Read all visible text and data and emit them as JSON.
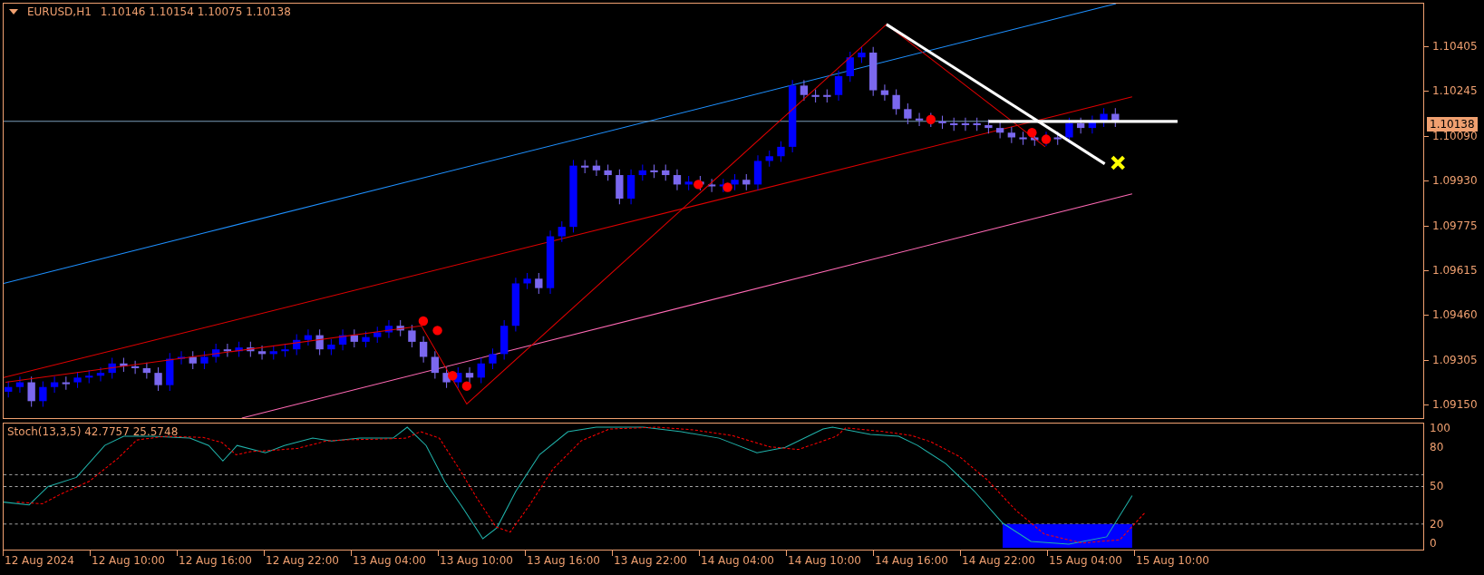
{
  "chart": {
    "symbol": "EURUSD,H1",
    "ohlc": "1.10146 1.10154 1.10075 1.10138",
    "current_price": "1.10138",
    "price_axis": [
      "1.10405",
      "1.10245",
      "1.10090",
      "1.09930",
      "1.09775",
      "1.09615",
      "1.09460",
      "1.09305",
      "1.09150"
    ]
  },
  "indicator": {
    "label": "Stoch(13,3,5) 42.7757 25.5748",
    "levels": [
      "100",
      "80",
      "50",
      "20",
      "0"
    ]
  },
  "time_axis": [
    "12 Aug 2024",
    "12 Aug 10:00",
    "12 Aug 16:00",
    "12 Aug 22:00",
    "13 Aug 04:00",
    "13 Aug 10:00",
    "13 Aug 16:00",
    "13 Aug 22:00",
    "14 Aug 04:00",
    "14 Aug 10:00",
    "14 Aug 16:00",
    "14 Aug 22:00",
    "15 Aug 04:00",
    "15 Aug 10:00"
  ]
}
